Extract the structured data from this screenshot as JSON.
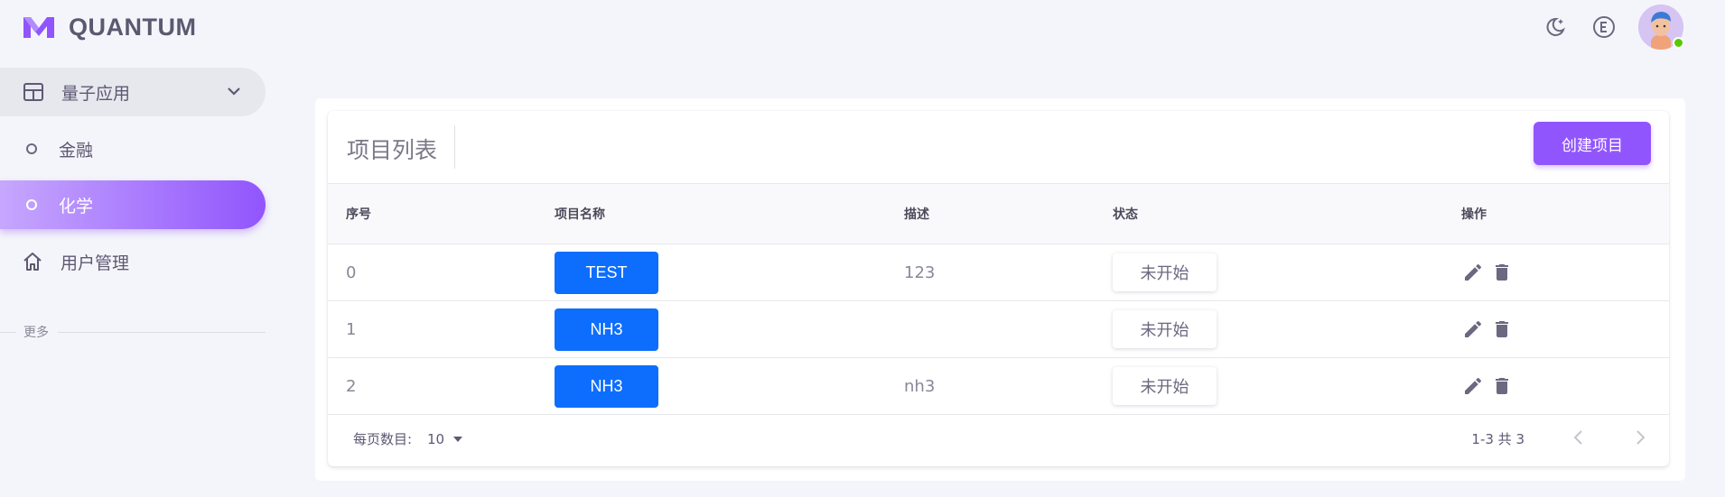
{
  "app": {
    "name": "QUANTUM"
  },
  "colors": {
    "primary": "#9155fd",
    "blue": "#0d6efd",
    "online": "#56ca00"
  },
  "topbar": {
    "icons": [
      "moon-icon",
      "e-icon",
      "avatar"
    ]
  },
  "sidebar": {
    "group": {
      "label": "量子应用",
      "icon": "table-icon",
      "expanded": true
    },
    "items": [
      {
        "label": "金融",
        "icon": "circle-icon",
        "active": false
      },
      {
        "label": "化学",
        "icon": "circle-icon",
        "active": true
      },
      {
        "label": "用户管理",
        "icon": "home-icon",
        "active": false
      }
    ],
    "section_title": "更多"
  },
  "card": {
    "title": "项目列表",
    "create_button": "创建项目",
    "columns": [
      "序号",
      "项目名称",
      "描述",
      "状态",
      "操作"
    ],
    "rows": [
      {
        "index": "0",
        "name": "TEST",
        "description": "123",
        "status": "未开始"
      },
      {
        "index": "1",
        "name": "NH3",
        "description": "",
        "status": "未开始"
      },
      {
        "index": "2",
        "name": "NH3",
        "description": "nh3",
        "status": "未开始"
      }
    ],
    "footer": {
      "rows_per_page_label": "每页数目:",
      "rows_per_page_value": "10",
      "range_text": "1-3 共 3"
    }
  }
}
